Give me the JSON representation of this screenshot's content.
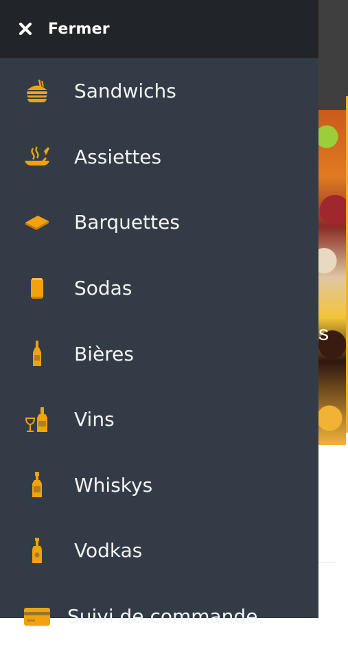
{
  "drawer": {
    "close_label": "Fermer",
    "accent_color": "#f2a20f",
    "items": [
      {
        "label": "Sandwichs",
        "icon": "burger-icon"
      },
      {
        "label": "Assiettes",
        "icon": "hot-plate-icon"
      },
      {
        "label": "Barquettes",
        "icon": "tray-icon"
      },
      {
        "label": "Sodas",
        "icon": "can-icon"
      },
      {
        "label": "Bières",
        "icon": "beer-bottle-icon"
      },
      {
        "label": "Vins",
        "icon": "wine-icon"
      },
      {
        "label": "Whiskys",
        "icon": "whisky-bottle-icon"
      },
      {
        "label": "Vodkas",
        "icon": "vodka-bottle-icon"
      },
      {
        "label": "Suivi de commande",
        "icon": "credit-card-icon"
      }
    ]
  },
  "background": {
    "hero_text_fragment": "s"
  }
}
